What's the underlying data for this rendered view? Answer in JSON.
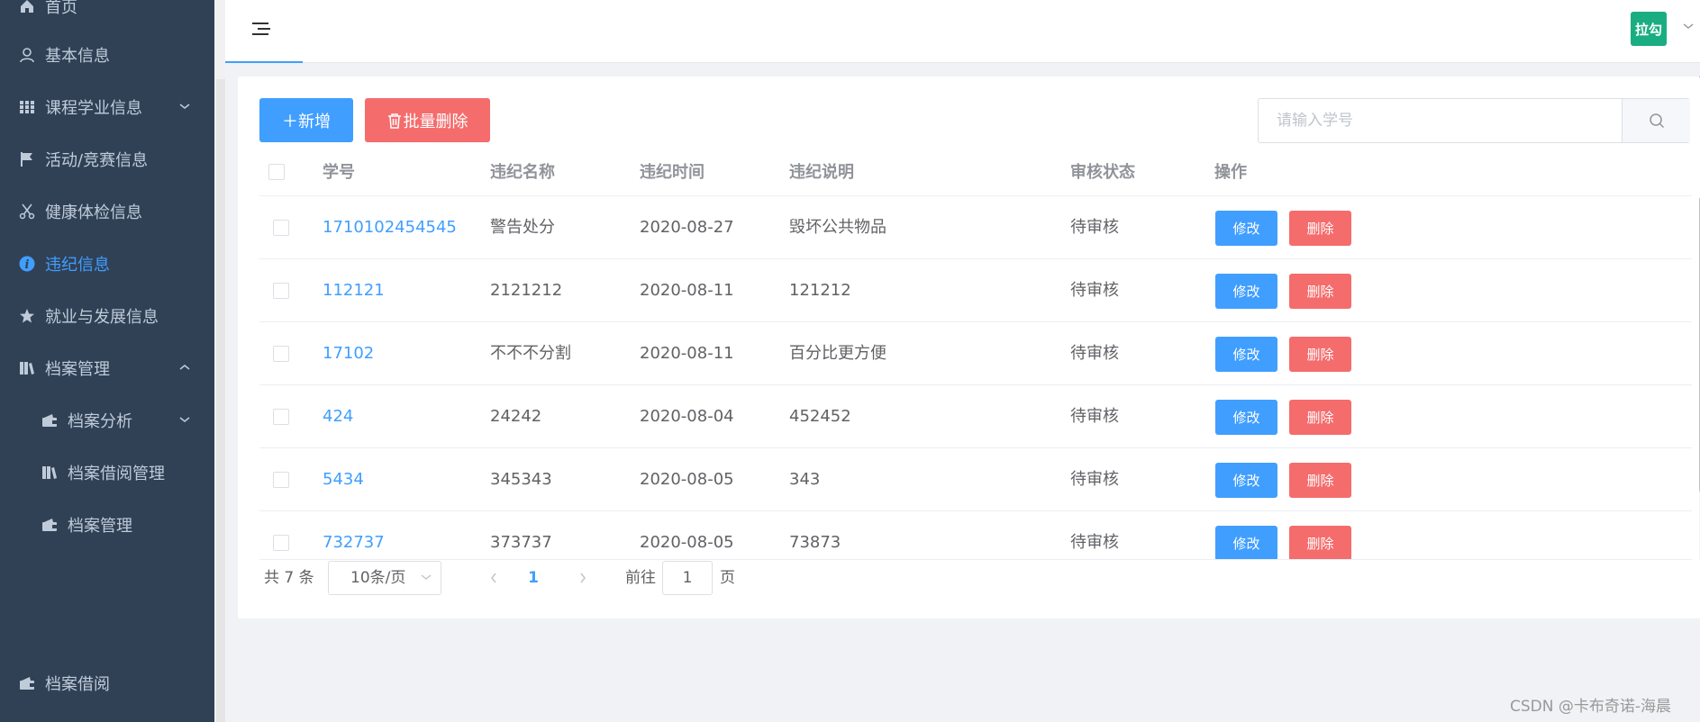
{
  "sidebar": {
    "items": [
      {
        "label": "首页",
        "icon": "home-icon"
      },
      {
        "label": "基本信息",
        "icon": "user-icon"
      },
      {
        "label": "课程学业信息",
        "icon": "grid-icon",
        "chevron": "⌄"
      },
      {
        "label": "活动/竞赛信息",
        "icon": "flag-icon"
      },
      {
        "label": "健康体检信息",
        "icon": "scissors-icon"
      },
      {
        "label": "违纪信息",
        "icon": "info-icon",
        "active": true
      },
      {
        "label": "就业与发展信息",
        "icon": "star-icon"
      },
      {
        "label": "档案管理",
        "icon": "archive-icon",
        "chevron": "⌃"
      },
      {
        "label": "档案分析",
        "icon": "wallet-icon",
        "chevron": "⌄",
        "sub": true
      },
      {
        "label": "档案借阅管理",
        "icon": "archive-icon",
        "sub": true
      },
      {
        "label": "档案管理",
        "icon": "wallet-icon",
        "sub": true
      },
      {
        "label": "档案借阅",
        "icon": "wallet-icon"
      }
    ]
  },
  "header": {
    "avatar_text": "拉勾"
  },
  "toolbar": {
    "add_label": "＋新增",
    "batch_delete_label": "批量删除",
    "search_placeholder": "请输入学号"
  },
  "table": {
    "columns": [
      "学号",
      "违纪名称",
      "违纪时间",
      "违纪说明",
      "审核状态",
      "操作"
    ],
    "rows": [
      {
        "id": "1710102454545",
        "name": "警告处分",
        "time": "2020-08-27",
        "desc": "毁坏公共物品",
        "status": "待审核"
      },
      {
        "id": "112121",
        "name": "2121212",
        "time": "2020-08-11",
        "desc": "121212",
        "status": "待审核"
      },
      {
        "id": "17102",
        "name": "不不不分割",
        "time": "2020-08-11",
        "desc": "百分比更方便",
        "status": "待审核"
      },
      {
        "id": "424",
        "name": "24242",
        "time": "2020-08-04",
        "desc": "452452",
        "status": "待审核"
      },
      {
        "id": "5434",
        "name": "345343",
        "time": "2020-08-05",
        "desc": "343",
        "status": "待审核"
      },
      {
        "id": "732737",
        "name": "373737",
        "time": "2020-08-05",
        "desc": "73873",
        "status": "待审核"
      }
    ],
    "edit_label": "修改",
    "delete_label": "删除"
  },
  "pagination": {
    "total_text": "共 7 条",
    "page_size": "10条/页",
    "current_page": "1",
    "goto_label": "前往",
    "goto_value": "1",
    "page_suffix": "页"
  },
  "watermark": "CSDN @卡布奇诺-海晨",
  "colors": {
    "sidebar_bg": "#304156",
    "primary": "#409eff",
    "danger": "#f56c6c",
    "avatar_bg": "#1aad82"
  }
}
